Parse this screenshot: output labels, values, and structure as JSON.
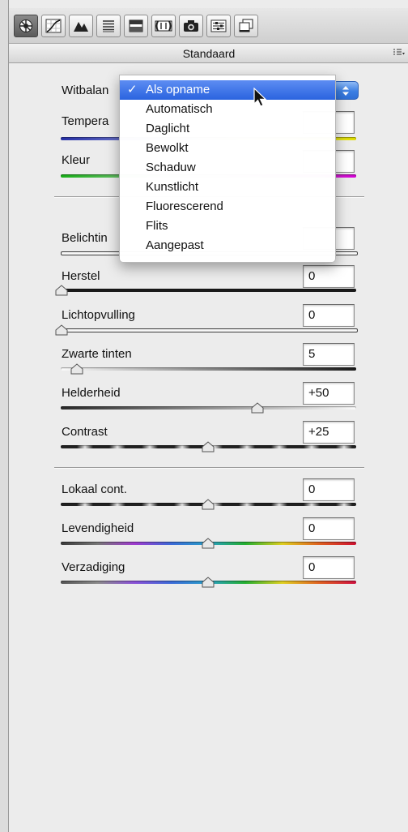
{
  "panel": {
    "section_title": "Standaard",
    "section_menu_icon": "list-menu-icon",
    "tools": [
      {
        "icon": "aperture-icon"
      },
      {
        "icon": "tone-curve-icon"
      },
      {
        "icon": "detail-triangle-icon"
      },
      {
        "icon": "hsl-grayscale-icon"
      },
      {
        "icon": "split-toning-icon"
      },
      {
        "icon": "lens-corrections-icon"
      },
      {
        "icon": "camera-calibration-icon"
      },
      {
        "icon": "presets-sliders-icon"
      },
      {
        "icon": "snapshots-icon"
      }
    ]
  },
  "white_balance": {
    "label": "Witbalan",
    "menu": {
      "items": [
        "Als opname",
        "Automatisch",
        "Daglicht",
        "Bewolkt",
        "Schaduw",
        "Kunstlicht",
        "Fluorescerend",
        "Flits",
        "Aangepast"
      ],
      "selected_index": 0,
      "check_glyph": "✓"
    }
  },
  "rows": {
    "temperatuur": {
      "label": "Tempera",
      "value": ""
    },
    "kleur": {
      "label": "Kleur",
      "value": ""
    },
    "belichting": {
      "label": "Belichtin",
      "value": ""
    },
    "herstel": {
      "label": "Herstel",
      "value": "0"
    },
    "lichtopvulling": {
      "label": "Lichtopvulling",
      "value": "0"
    },
    "zwarte_tinten": {
      "label": "Zwarte tinten",
      "value": "5"
    },
    "helderheid": {
      "label": "Helderheid",
      "value": "+50"
    },
    "contrast": {
      "label": "Contrast",
      "value": "+25"
    },
    "lokaal_cont": {
      "label": "Lokaal cont.",
      "value": "0"
    },
    "levendigheid": {
      "label": "Levendigheid",
      "value": "0"
    },
    "verzadiging": {
      "label": "Verzadiging",
      "value": "0"
    }
  },
  "colors": {
    "menu_highlight": "#2a63df",
    "popup_button": "#3c7fe3"
  }
}
